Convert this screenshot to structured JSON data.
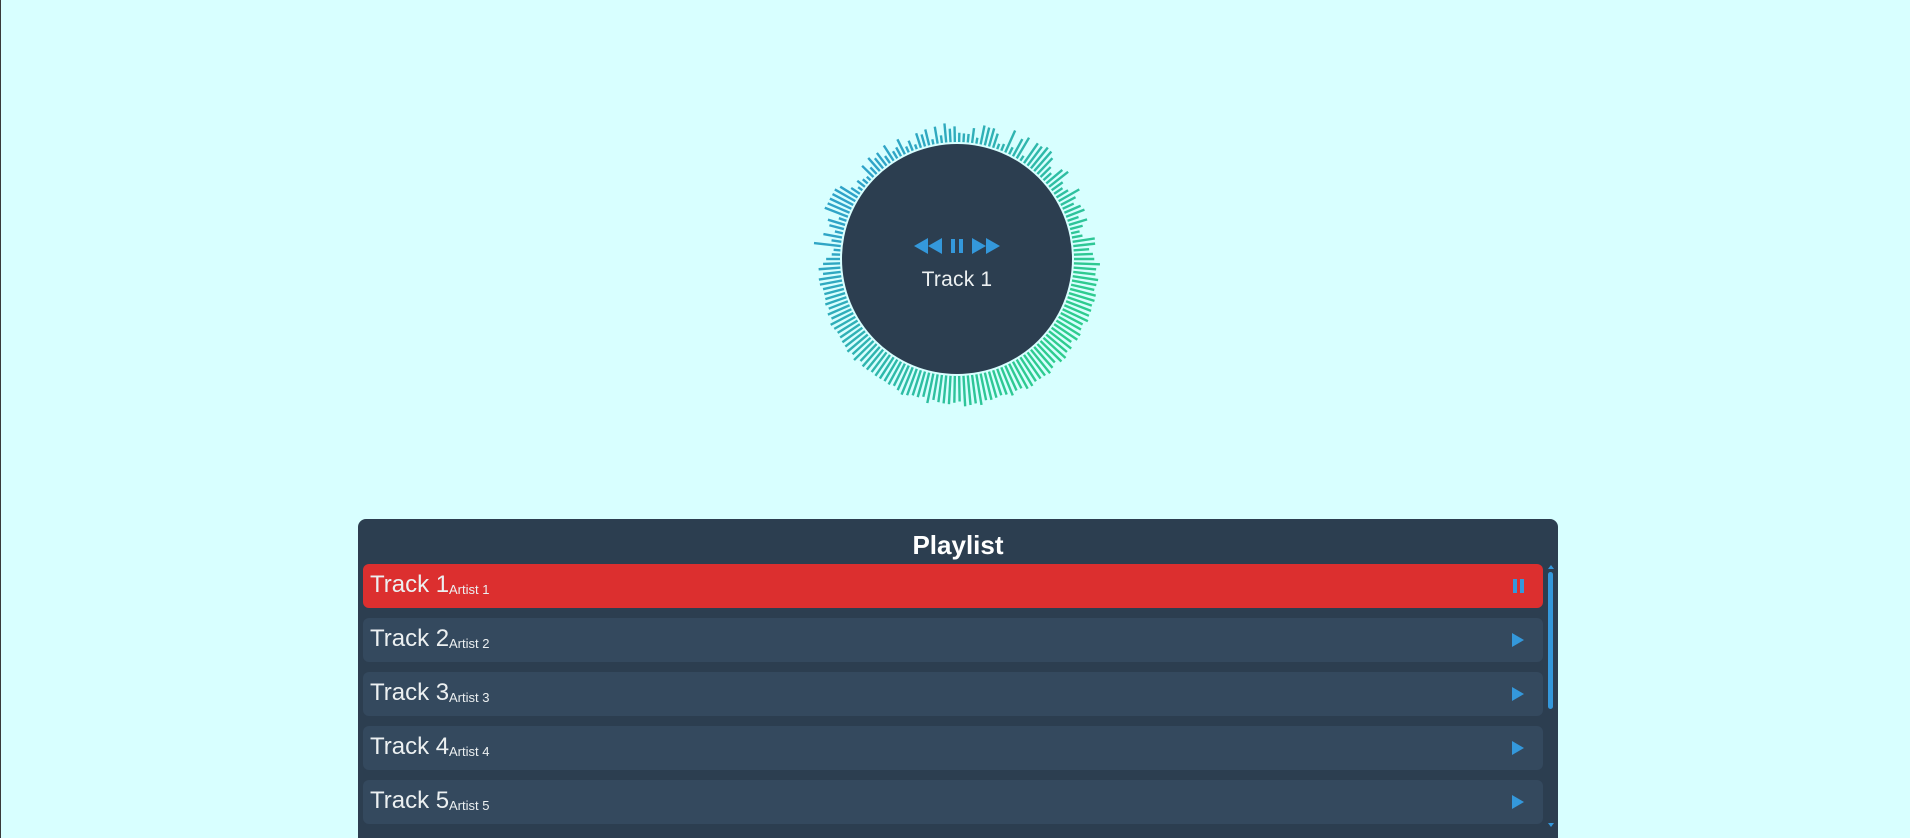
{
  "now_playing": {
    "title": "Track 1"
  },
  "controls": {
    "prev_icon": "rewind-icon",
    "play_pause_icon": "pause-icon",
    "next_icon": "fast-forward-icon"
  },
  "playlist": {
    "title": "Playlist",
    "tracks": [
      {
        "title": "Track 1",
        "artist": "Artist 1",
        "active": true,
        "icon": "pause-icon"
      },
      {
        "title": "Track 2",
        "artist": "Artist 2",
        "active": false,
        "icon": "play-icon"
      },
      {
        "title": "Track 3",
        "artist": "Artist 3",
        "active": false,
        "icon": "play-icon"
      },
      {
        "title": "Track 4",
        "artist": "Artist 4",
        "active": false,
        "icon": "play-icon"
      },
      {
        "title": "Track 5",
        "artist": "Artist 5",
        "active": false,
        "icon": "play-icon"
      }
    ]
  },
  "colors": {
    "background": "#d8ffff",
    "panel": "#2c3e50",
    "row": "#34495e",
    "active_row": "#dc2f2f",
    "accent": "#3498db",
    "viz_cool": "#2fa3c8",
    "viz_warm": "#2ecc8e"
  }
}
